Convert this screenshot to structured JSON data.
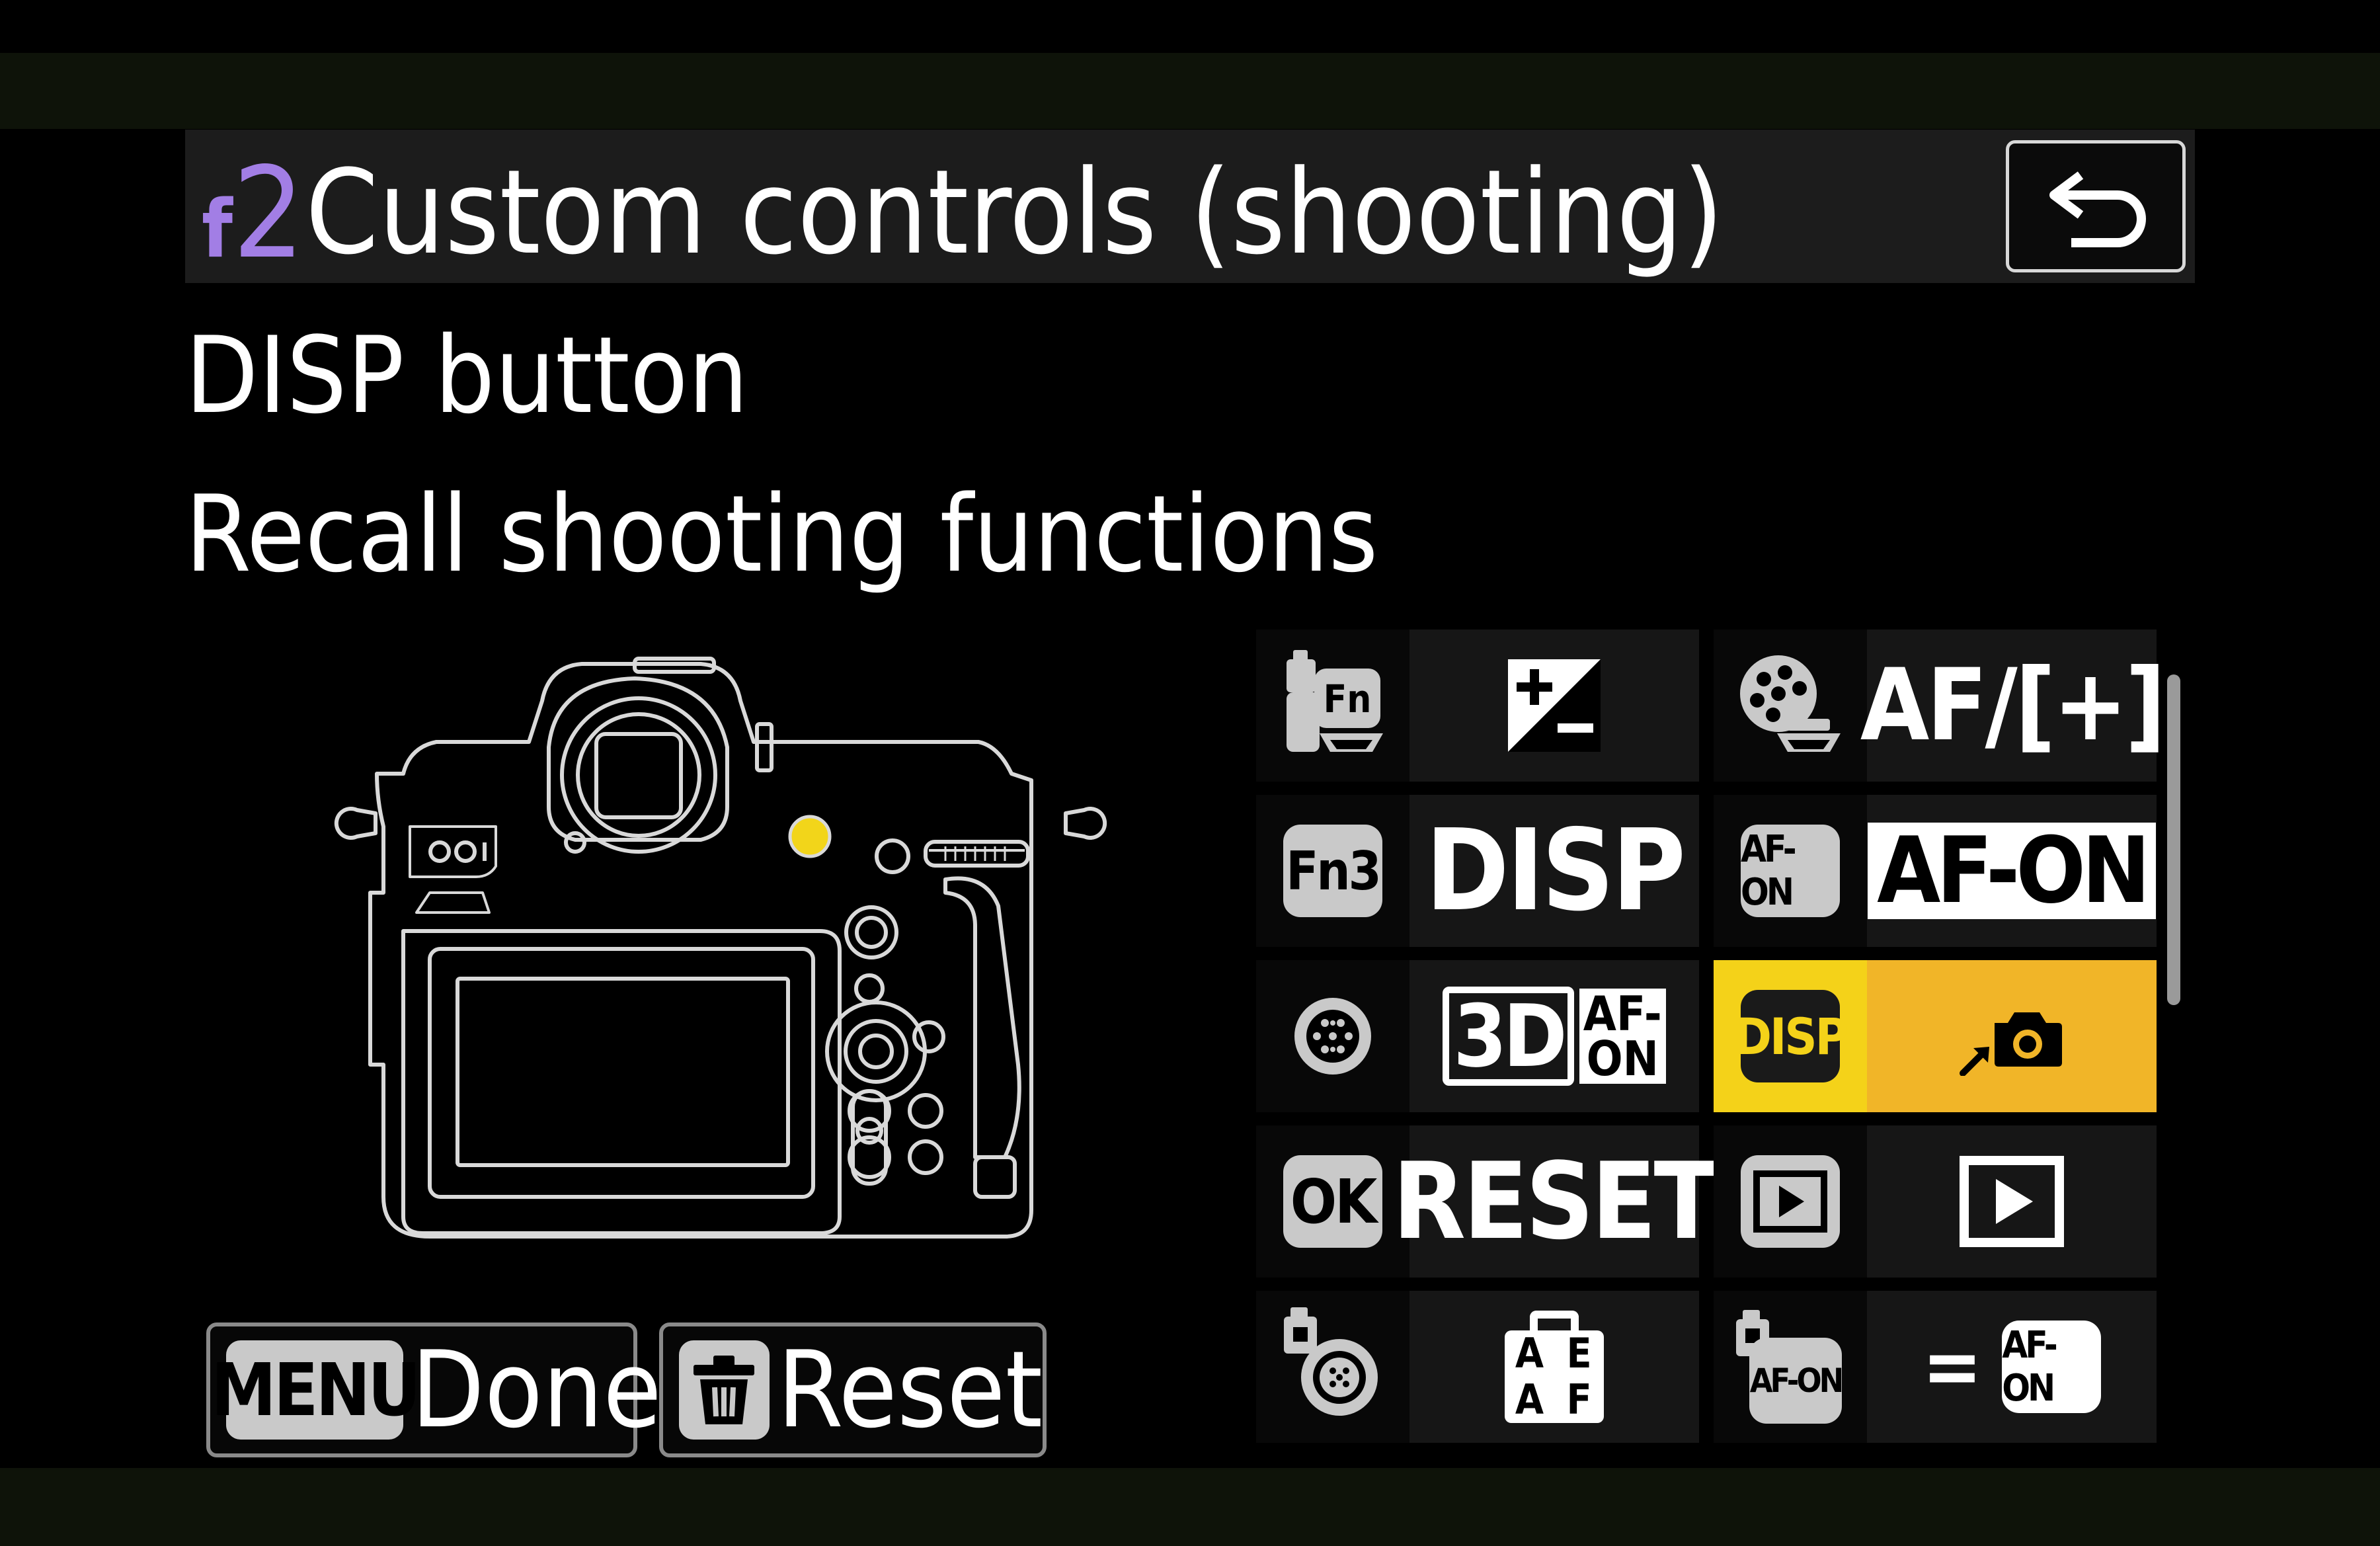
{
  "header": {
    "menu_letter": "f",
    "menu_number": "2",
    "title": "Custom controls (shooting)",
    "back_icon": "return-arrow-icon"
  },
  "control": {
    "name": "DISP button",
    "assignment": "Recall shooting functions"
  },
  "footer": {
    "done_key": "MENU",
    "done_label": "Done",
    "reset_label": "Reset"
  },
  "grid": {
    "left_column": [
      {
        "icon": "fn-lever-icon",
        "value_icon": "exposure-compensation-icon"
      },
      {
        "key": "Fn3",
        "value": "DISP"
      },
      {
        "icon": "sub-selector-icon",
        "value_icon": "3d-tracking-af-on-icon",
        "value_3d": "3D",
        "value_af": "AF-",
        "value_on": "ON"
      },
      {
        "key": "OK",
        "value": "RESET"
      },
      {
        "icon": "sub-selector-center-icon",
        "value_icon": "ae-af-lock-icon",
        "value_ae_a": "A",
        "value_ae_e": "E",
        "value_af_a": "A",
        "value_af_f": "F"
      }
    ],
    "right_column": [
      {
        "icon": "control-dial-icon",
        "value": "AF/[+]"
      },
      {
        "key": "AF-ON",
        "value": "AF-ON"
      },
      {
        "key": "DISP",
        "value_icon": "recall-shooting-functions-icon",
        "selected": true
      },
      {
        "icon": "playback-button-icon",
        "value_icon": "playback-icon"
      },
      {
        "key": "AF-ON",
        "icon": "vertical-af-on-icon",
        "value_eq": "=",
        "value_key": "AF-ON"
      }
    ]
  },
  "colors": {
    "accent_purple": "#a27ee5",
    "selected_yellow": "#f4d219",
    "selected_orange": "#f1b528",
    "button_highlight": "#f2d51a"
  }
}
